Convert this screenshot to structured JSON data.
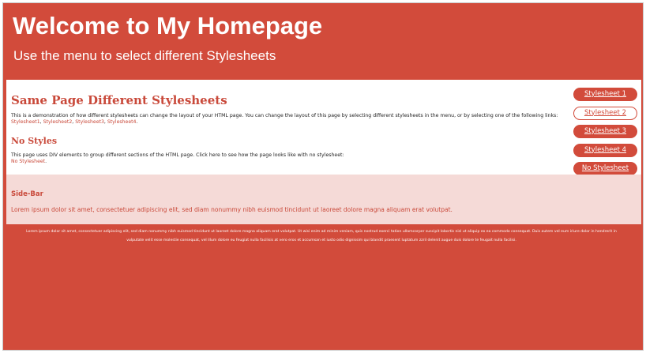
{
  "header": {
    "title": "Welcome to My Homepage",
    "subtitle": "Use the menu to select different Stylesheets"
  },
  "content": {
    "heading": "Same Page Different Stylesheets",
    "intro_text": "This is a demonstration of how different stylesheets can change the layout of your HTML page. You can change the layout of this page by selecting different stylesheets in the menu, or by selecting one of the following links:",
    "links": [
      "Stylesheet1",
      "Stylesheet2",
      "Stylesheet3",
      "Stylesheet4"
    ],
    "sep": ", ",
    "period": ".",
    "no_styles_heading": "No Styles",
    "no_styles_text": "This page uses DIV elements to group different sections of the HTML page. Click here to see how the page looks like with no stylesheet:",
    "no_styles_link": "No Stylesheet"
  },
  "menu": {
    "items": [
      {
        "label": "Stylesheet 1"
      },
      {
        "label": "Stylesheet 2",
        "selected": true
      },
      {
        "label": "Stylesheet 3"
      },
      {
        "label": "Stylesheet 4"
      },
      {
        "label": "No Stylesheet"
      }
    ]
  },
  "sidebar": {
    "title": "Side-Bar",
    "text": "Lorem ipsum dolor sit amet, consectetuer adipiscing elit, sed diam nonummy nibh euismod tincidunt ut laoreet dolore magna aliquam erat volutpat."
  },
  "footer": {
    "text": "Lorem ipsum dolor sit amet, consectetuer adipiscing elit, sed diam nonummy nibh euismod tincidunt ut laoreet dolore magna aliquam erat volutpat. Ut wisi enim ad minim veniam, quis nostrud exerci tation ullamcorper suscipit lobortis nisl ut aliquip ex ea commodo consequat. Duis autem vel eum iriure dolor in hendrerit in vulputate velit esse molestie consequat, vel illum dolore eu feugiat nulla facilisis at vero eros et accumsan et iusto odio dignissim qui blandit praesent luptatum zzril delenit augue duis dolore te feugait nulla facilisi."
  },
  "colors": {
    "accent": "#d24b3b",
    "sidebar_bg": "#f5dad7",
    "text_link": "#c9493a"
  }
}
